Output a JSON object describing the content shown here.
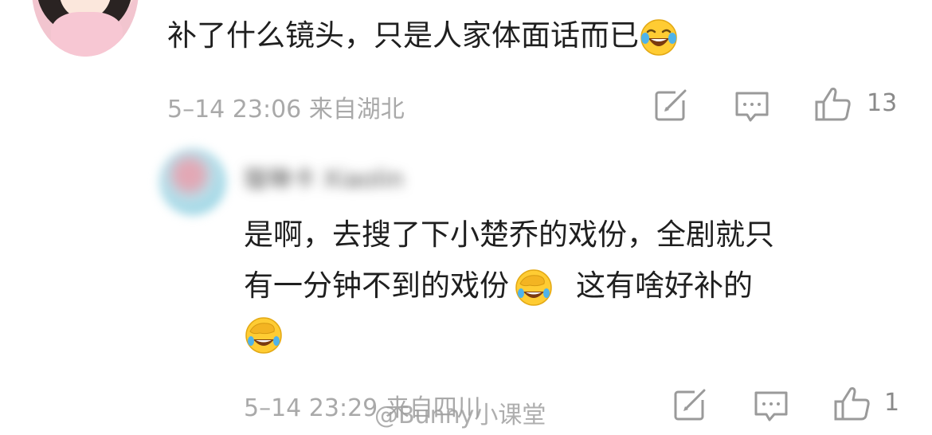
{
  "comments": [
    {
      "text": "补了什么镜头，只是人家体面话而已",
      "emoji_end": "laughing-tears-emoji",
      "time": "5–14 23:06",
      "location": "来自湖北",
      "likes": "13"
    },
    {
      "username": "璇琳卡 Xiaolin",
      "text_line1": "是啊，去搜了下小楚乔的戏份，全剧就只",
      "text_line2a": "有一分钟不到的戏份",
      "text_line2b": "这有啥好补的",
      "time": "5–14 23:29",
      "location": "来自四川",
      "likes": "1"
    }
  ],
  "watermark": "@Bunny小课堂",
  "colors": {
    "meta": "#a9a9a9",
    "text": "#1f1f1f",
    "icon": "#9a9a9a",
    "emoji_face": "#ffcc33"
  },
  "icons": [
    "share-icon",
    "comment-icon",
    "thumbs-up-icon"
  ]
}
